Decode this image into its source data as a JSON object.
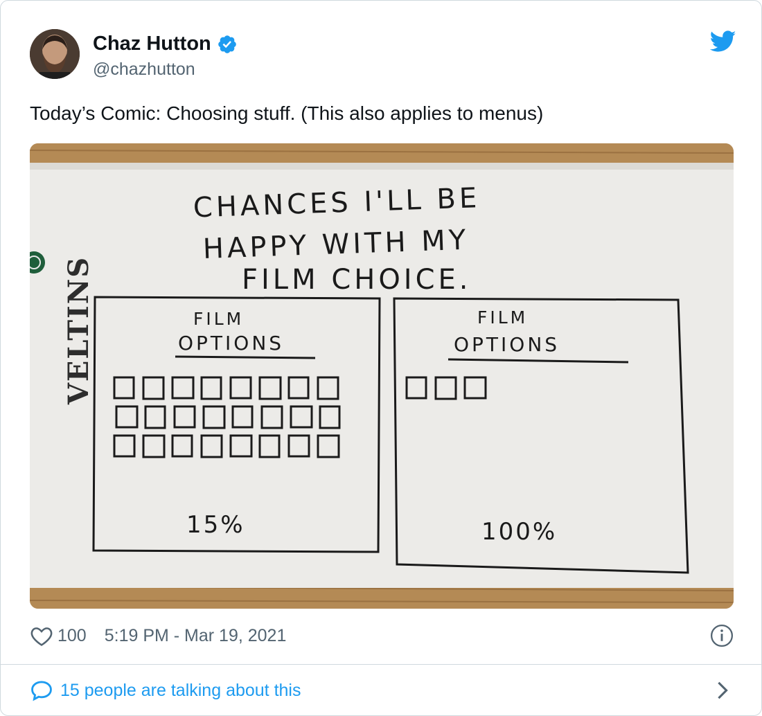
{
  "author": {
    "name": "Chaz Hutton",
    "handle": "@chazhutton",
    "verified": true
  },
  "tweet": {
    "text": "Today’s Comic: Choosing stuff. (This also applies to menus)",
    "likes": "100",
    "timestamp": "5:19 PM - Mar 19, 2021"
  },
  "comic": {
    "brand": "VELTINS",
    "title_lines": [
      "CHANCES I'LL BE",
      "HAPPY WITH MY",
      "FILM CHOICE."
    ],
    "left_panel": {
      "label_line1": "FILM",
      "label_line2": "OPTIONS",
      "options": 24,
      "percent": "15%"
    },
    "right_panel": {
      "label_line1": "FILM",
      "label_line2": "OPTIONS",
      "options": 3,
      "percent": "100%"
    }
  },
  "footer": {
    "talking_text": "15 people are talking about this"
  },
  "colors": {
    "link_blue": "#1d9bf0",
    "muted_text": "#536471",
    "brand_green": "#1f5e3b"
  },
  "icons": [
    "verified-badge-icon",
    "twitter-bird-icon",
    "heart-icon",
    "info-icon",
    "speech-bubble-icon",
    "chevron-right-icon"
  ]
}
